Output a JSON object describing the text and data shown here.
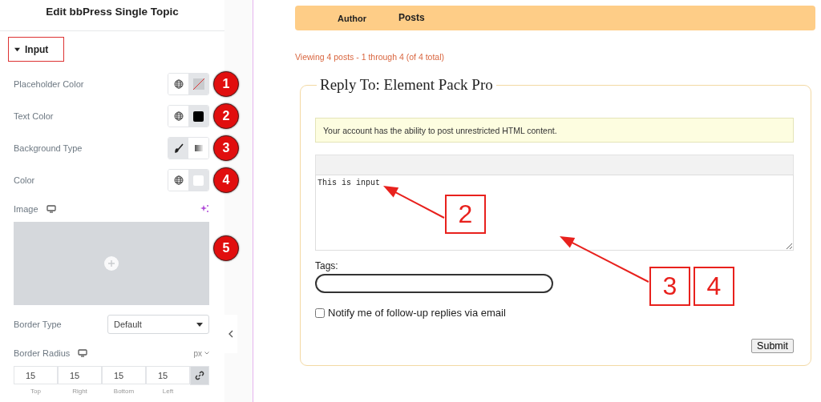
{
  "panel": {
    "title": "Edit bbPress Single Topic",
    "section": {
      "label": "Input",
      "expanded": true
    },
    "controls": [
      {
        "kind": "color",
        "label": "Placeholder Color",
        "badge": "1"
      },
      {
        "kind": "color",
        "label": "Text Color",
        "color": "#000000",
        "badge": "2"
      },
      {
        "kind": "toggle",
        "label": "Background Type",
        "options": [
          {
            "selected": true
          },
          {
            "selected": false
          }
        ],
        "badge": "3"
      },
      {
        "kind": "color",
        "label": "Color",
        "color": "#ffffff",
        "badge": "4"
      },
      {
        "kind": "image",
        "label": "Image",
        "badge": "5"
      },
      {
        "kind": "select",
        "label": "Border Type",
        "value": "Default"
      },
      {
        "kind": "dimensions",
        "label": "Border Radius",
        "unit": "px",
        "linked": true,
        "fields": [
          {
            "value": "15",
            "label": "Top"
          },
          {
            "value": "15",
            "label": "Right"
          },
          {
            "value": "15",
            "label": "Bottom"
          },
          {
            "value": "15",
            "label": "Left"
          }
        ]
      }
    ]
  },
  "page": {
    "columns": [
      "Author",
      "Posts"
    ],
    "viewing": "Viewing 4 posts - 1 through 4 (of 4 total)",
    "form": {
      "legend": "Reply To: Element Pack Pro",
      "notice": "Your account has the ability to post unrestricted HTML content.",
      "editor_value": "This is input",
      "tags_label": "Tags:",
      "notify": {
        "label": "Notify me of follow-up replies via email",
        "checked": false
      },
      "submit": "Submit"
    },
    "annotations": [
      {
        "labels": [
          "2"
        ]
      },
      {
        "labels": [
          "3",
          "4"
        ]
      }
    ]
  }
}
